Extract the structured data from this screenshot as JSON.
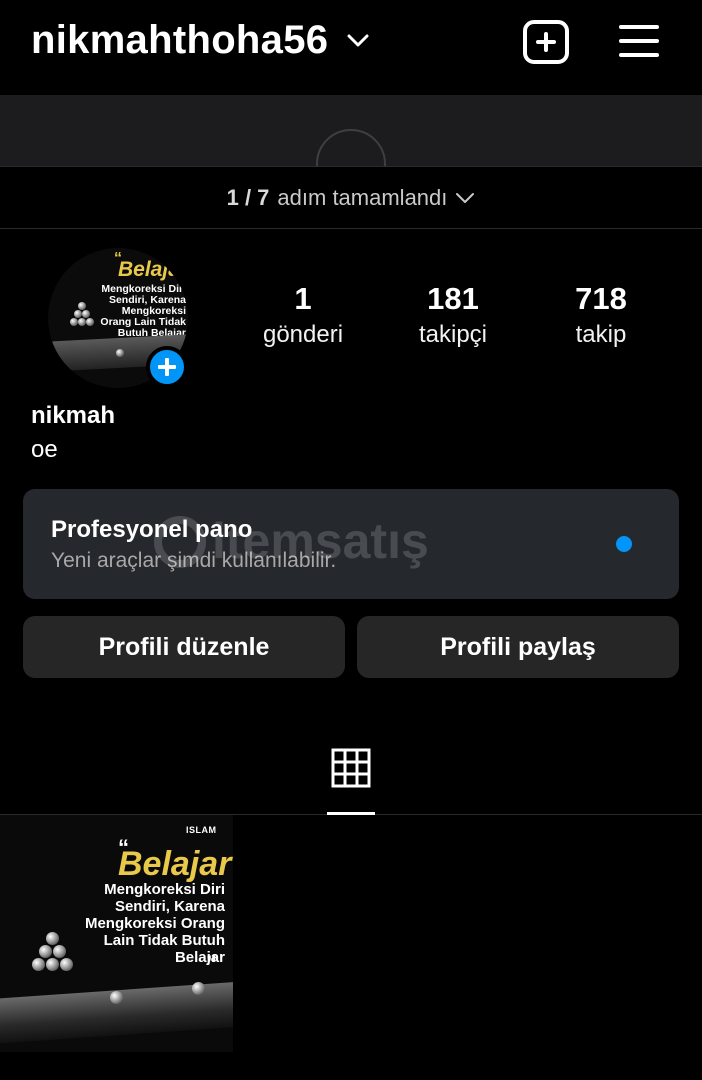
{
  "header": {
    "username": "nikmahthoha56",
    "create_icon": "plus-square-icon",
    "menu_icon": "hamburger-menu-icon"
  },
  "steps": {
    "progress": "1 / 7",
    "label": "adım tamamlandı"
  },
  "profile": {
    "full_name": "nikmah",
    "bio": "oe",
    "avatar_post": {
      "title": "Belaja",
      "text": "Mengkoreksi Diri Sendiri, Karena Mengkoreksi Orang Lain Tidak Butuh Belajar"
    }
  },
  "stats": [
    {
      "value": "1",
      "label": "gönderi"
    },
    {
      "value": "181",
      "label": "takipçi"
    },
    {
      "value": "718",
      "label": "takip"
    }
  ],
  "dashboard": {
    "title": "Profesyonel pano",
    "subtitle": "Yeni araçlar şimdi kullanılabilir.",
    "watermark": "itemsatış"
  },
  "buttons": {
    "edit": "Profili düzenle",
    "share": "Profili paylaş"
  },
  "tabs": {
    "active": "grid-icon"
  },
  "posts": [
    {
      "brand": "ISLAM",
      "title": "Belajar",
      "text": "Mengkoreksi Diri Sendiri, Karena Mengkoreksi Orang Lain Tidak Butuh Belajar"
    }
  ],
  "colors": {
    "background": "#000000",
    "accent": "#0095f6",
    "card": "#25282d",
    "button": "#262626",
    "highlight": "#e9c94a"
  }
}
